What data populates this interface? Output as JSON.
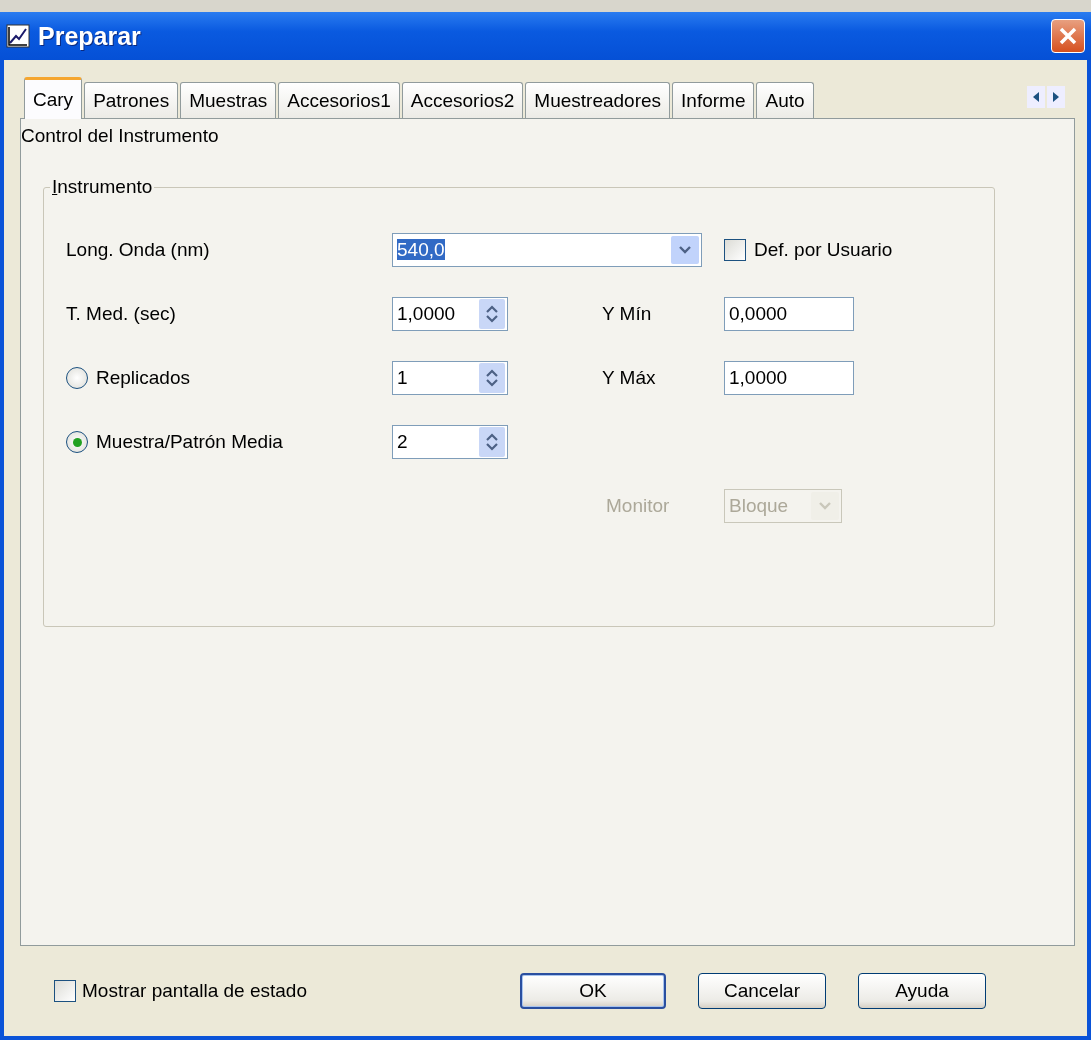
{
  "window": {
    "title": "Preparar"
  },
  "tabs": [
    {
      "label": "Cary",
      "selected": true
    },
    {
      "label": "Patrones",
      "selected": false
    },
    {
      "label": "Muestras",
      "selected": false
    },
    {
      "label": "Accesorios1",
      "selected": false
    },
    {
      "label": "Accesorios2",
      "selected": false
    },
    {
      "label": "Muestreadores",
      "selected": false
    },
    {
      "label": "Informe",
      "selected": false
    },
    {
      "label": "Auto",
      "selected": false
    }
  ],
  "section_label": "Control del Instrumento",
  "group": {
    "title": "Instrumento",
    "fields": [
      {
        "kind": "combo",
        "label": "Long. Onda (nm)",
        "value": "540,0",
        "highlighted": true
      },
      {
        "kind": "spin",
        "label": "T. Med. (sec)",
        "value": "1,0000"
      },
      {
        "kind": "radio-spin",
        "label": "Replicados",
        "selected": false,
        "value": "1"
      },
      {
        "kind": "radio-spin",
        "label": "Muestra/Patrón Media",
        "selected": true,
        "value": "2"
      }
    ],
    "side_fields": [
      {
        "kind": "checkbox",
        "label": "Def. por Usuario",
        "checked": false
      },
      {
        "kind": "text",
        "label": "Y Mín",
        "value": "0,0000"
      },
      {
        "kind": "text",
        "label": "Y Máx",
        "value": "1,0000"
      },
      {
        "kind": "combo",
        "label": "Monitor",
        "value": "Bloque",
        "disabled": true
      }
    ]
  },
  "status_checkbox": {
    "label": "Mostrar pantalla de estado",
    "checked": false
  },
  "buttons": [
    {
      "label": "OK",
      "default": true
    },
    {
      "label": "Cancelar",
      "default": false
    },
    {
      "label": "Ayuda",
      "default": false
    }
  ]
}
